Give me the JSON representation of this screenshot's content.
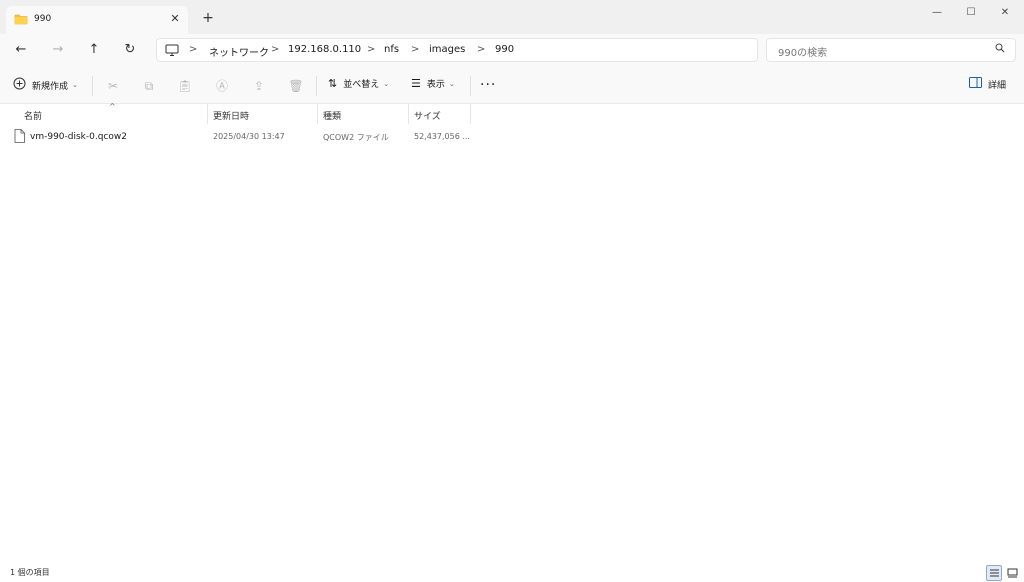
{
  "tab": {
    "title": "990",
    "close": "✕",
    "new_tab": "+"
  },
  "window": {
    "minimize": "—",
    "maximize": "☐",
    "close": "✕"
  },
  "nav": {
    "back": "←",
    "forward": "→",
    "up": "↑",
    "refresh": "↻"
  },
  "breadcrumb": {
    "separator": ">",
    "items": [
      "ネットワーク",
      "192.168.0.110",
      "nfs",
      "images",
      "990"
    ]
  },
  "search": {
    "placeholder": "990の検索"
  },
  "toolbar": {
    "new_label": "新規作成",
    "sort_label": "並べ替え",
    "view_label": "表示",
    "details_label": "詳細"
  },
  "columns": {
    "name": "名前",
    "date": "更新日時",
    "type": "種類",
    "size": "サイズ"
  },
  "files": [
    {
      "name": "vm-990-disk-0.qcow2",
      "date": "2025/04/30 13:47",
      "type": "QCOW2 ファイル",
      "size": "52,437,056 ..."
    }
  ],
  "status": {
    "item_count": "1 個の項目"
  },
  "colors": {
    "accent": "#0078d4",
    "folder": "#f5c342"
  }
}
